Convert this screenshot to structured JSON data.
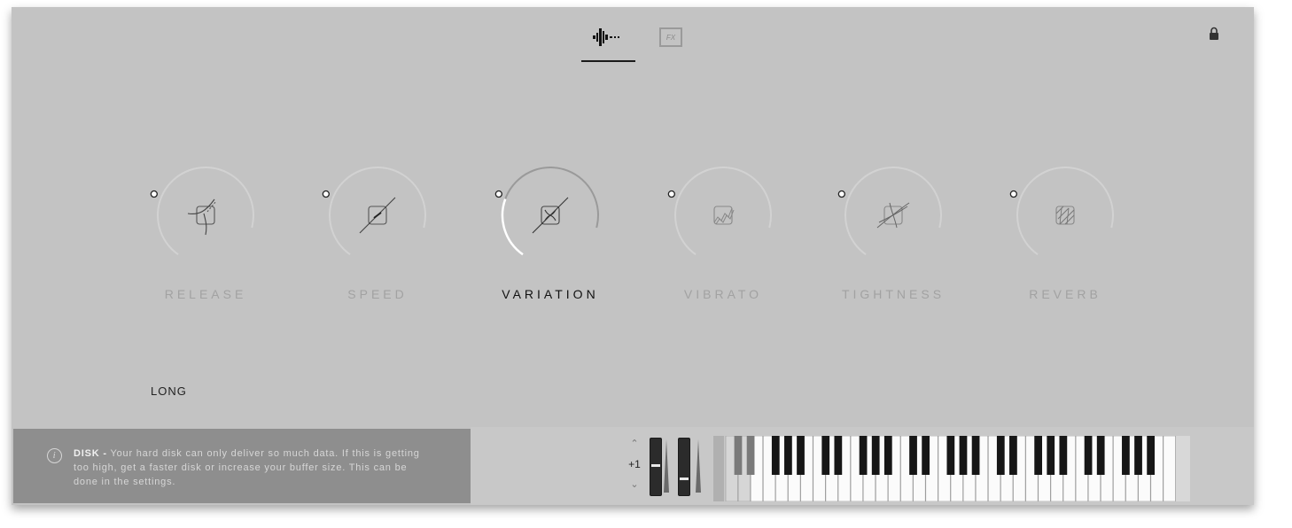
{
  "tabs": [
    {
      "name": "waveform-tab",
      "icon": "waveform-icon",
      "active": true
    },
    {
      "name": "fx-tab",
      "icon": "fx-icon",
      "label": "FX",
      "active": false
    }
  ],
  "lock": {
    "icon": "lock-icon"
  },
  "knobs": [
    {
      "label": "RELEASE",
      "icon": "release-glyph-icon",
      "value": 0.0,
      "active": false
    },
    {
      "label": "SPEED",
      "icon": "speed-glyph-icon",
      "value": 0.0,
      "active": false
    },
    {
      "label": "VARIATION",
      "icon": "variation-glyph-icon",
      "value": 0.3,
      "active": true
    },
    {
      "label": "VIBRATO",
      "icon": "vibrato-glyph-icon",
      "value": 0.0,
      "active": false
    },
    {
      "label": "TIGHTNESS",
      "icon": "tightness-glyph-icon",
      "value": 0.0,
      "active": false
    },
    {
      "label": "REVERB",
      "icon": "reverb-glyph-icon",
      "value": 0.0,
      "active": false
    }
  ],
  "articulation": {
    "label": "LONG"
  },
  "info": {
    "icon": "info-icon",
    "title": "DISK -",
    "message": "Your hard disk can only deliver so much data. If this is getting too high, get a faster disk or increase your buffer size. This can be done in the settings."
  },
  "octave": {
    "up_icon": "chevron-up-icon",
    "value": "+1",
    "down_icon": "chevron-down-icon"
  },
  "wheels": [
    {
      "name": "pitch-wheel",
      "level": 0.5
    },
    {
      "name": "mod-wheel",
      "level": 0.25
    }
  ],
  "colors": {
    "panel": "#c3c3c3",
    "arc_inactive": "#d2d2d2",
    "arc_active": "#9a9a9a",
    "arc_value": "#ffffff",
    "accent_dark": "#1a1a1a"
  }
}
